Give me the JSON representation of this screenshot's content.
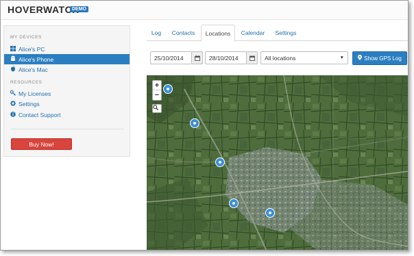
{
  "header": {
    "logo": "HOVERWATCH",
    "badge": "DEMO"
  },
  "sidebar": {
    "my_devices_title": "MY DEVICES",
    "devices": [
      {
        "label": "Alice's PC",
        "icon": "windows-icon",
        "active": false
      },
      {
        "label": "Alice's Phone",
        "icon": "android-icon",
        "active": true
      },
      {
        "label": "Alice's Mac",
        "icon": "apple-icon",
        "active": false
      }
    ],
    "resources_title": "RESOURCES",
    "resources": [
      {
        "label": "My Licenses",
        "icon": "key-icon"
      },
      {
        "label": "Settings",
        "icon": "gear-icon"
      },
      {
        "label": "Contact Support",
        "icon": "info-icon"
      }
    ],
    "buy_label": "Buy Now!"
  },
  "tabs": [
    {
      "label": "Log",
      "active": false
    },
    {
      "label": "Contacts",
      "active": false
    },
    {
      "label": "Locations",
      "active": true
    },
    {
      "label": "Calendar",
      "active": false
    },
    {
      "label": "Settings",
      "active": false
    }
  ],
  "filters": {
    "date_from": "25/10/2014",
    "date_to": "28/10/2014",
    "location_select": "All locations",
    "gps_button": "Show GPS Log"
  },
  "map": {
    "zoom_in": "+",
    "zoom_out": "−",
    "marker_count": 5,
    "marker_color": "#3b8fd6"
  },
  "colors": {
    "accent": "#2b7fc1",
    "danger": "#d9443c",
    "link": "#1f6fae"
  }
}
